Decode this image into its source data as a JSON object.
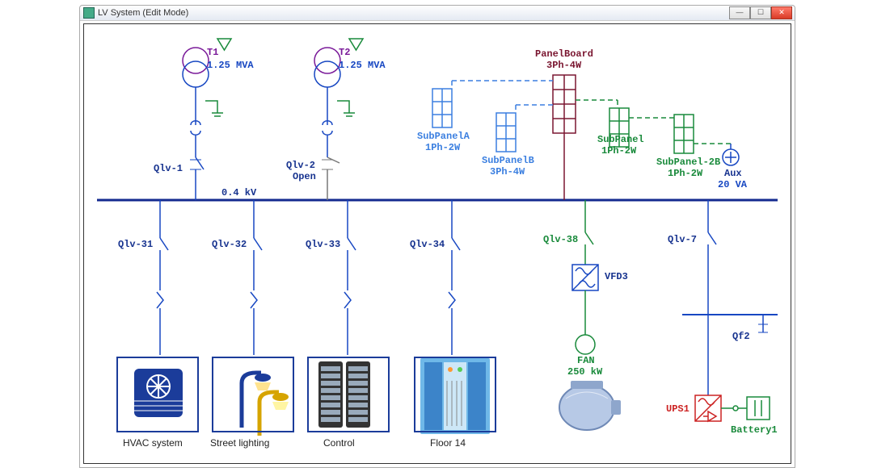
{
  "window": {
    "title": "LV System (Edit Mode)"
  },
  "transformers": {
    "t1": {
      "name": "T1",
      "rating": "1.25 MVA"
    },
    "t2": {
      "name": "T2",
      "rating": "1.25 MVA"
    }
  },
  "bus": {
    "voltage": "0.4 kV"
  },
  "breakers": {
    "qlv1": {
      "name": "Qlv-1"
    },
    "qlv2": {
      "name": "Qlv-2",
      "state": "Open"
    },
    "qlv31": {
      "name": "Qlv-31"
    },
    "qlv32": {
      "name": "Qlv-32"
    },
    "qlv33": {
      "name": "Qlv-33"
    },
    "qlv34": {
      "name": "Qlv-34"
    },
    "qlv38": {
      "name": "Qlv-38"
    },
    "qlv7": {
      "name": "Qlv-7"
    },
    "qf2": {
      "name": "Qf2"
    }
  },
  "panels": {
    "main": {
      "name": "PanelBoard",
      "type": "3Ph-4W"
    },
    "subA": {
      "name": "SubPanelA",
      "type": "1Ph-2W"
    },
    "subB": {
      "name": "SubPanelB",
      "type": "3Ph-4W"
    },
    "sub1": {
      "name": "SubPanel",
      "type": "1Ph-2W"
    },
    "sub2B": {
      "name": "SubPanel-2B",
      "type": "1Ph-2W"
    }
  },
  "aux": {
    "name": "Aux",
    "rating": "20 VA"
  },
  "vfd": {
    "name": "VFD3"
  },
  "fan": {
    "name": "FAN",
    "rating": "250 kW"
  },
  "ups": {
    "name": "UPS1"
  },
  "battery": {
    "name": "Battery1"
  },
  "loads": {
    "hvac": {
      "label": "HVAC system"
    },
    "street": {
      "label": "Street lighting"
    },
    "control": {
      "label": "Control"
    },
    "floor": {
      "label": "Floor 14"
    }
  }
}
